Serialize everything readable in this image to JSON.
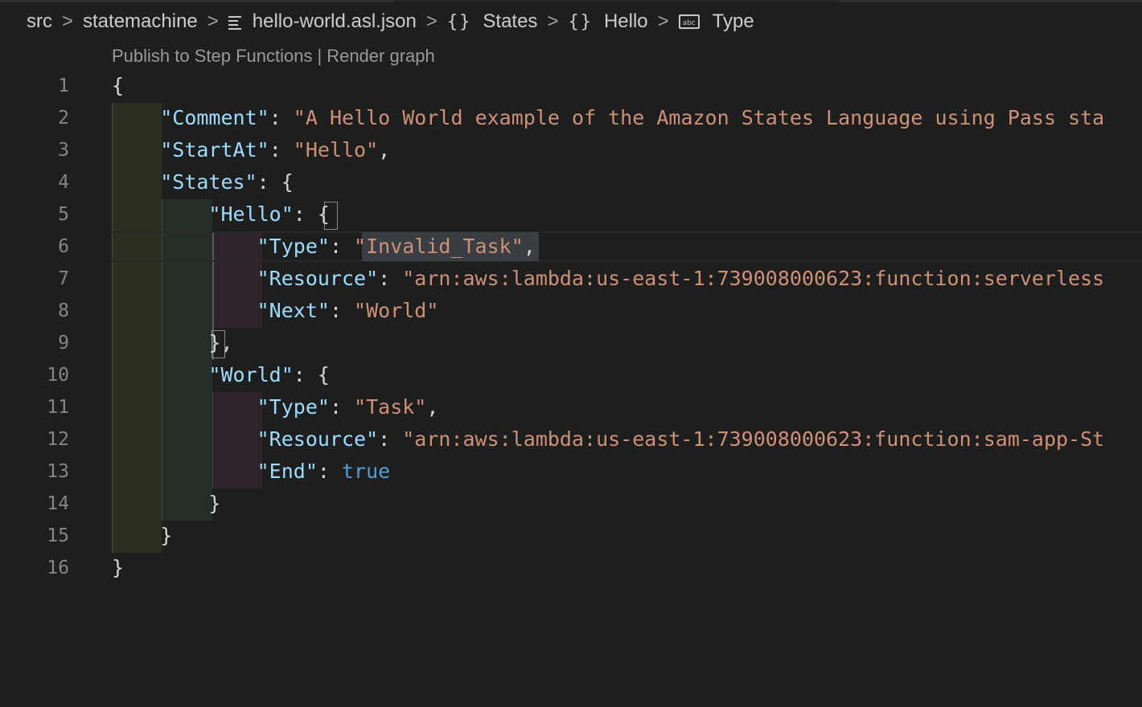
{
  "breadcrumb": {
    "items": [
      {
        "label": "src"
      },
      {
        "label": "statemachine"
      },
      {
        "label": "hello-world.asl.json",
        "icon": "file-lines-icon"
      },
      {
        "label": "States",
        "icon": "braces-icon"
      },
      {
        "label": "Hello",
        "icon": "braces-icon"
      },
      {
        "label": "Type",
        "icon": "string-abc-icon"
      }
    ],
    "separator": ">",
    "braces_glyph": "{}",
    "abc_glyph": "abc"
  },
  "codelens": {
    "publish": "Publish to Step Functions",
    "separator": "|",
    "render": "Render graph"
  },
  "line_numbers": [
    "1",
    "2",
    "3",
    "4",
    "5",
    "6",
    "7",
    "8",
    "9",
    "10",
    "11",
    "12",
    "13",
    "14",
    "15",
    "16"
  ],
  "code": {
    "l1": {
      "brace": "{"
    },
    "l2": {
      "key": "\"Comment\"",
      "colon": ": ",
      "value": "\"A Hello World example of the Amazon States Language using Pass sta"
    },
    "l3": {
      "key": "\"StartAt\"",
      "colon": ": ",
      "value": "\"Hello\"",
      "comma": ","
    },
    "l4": {
      "key": "\"States\"",
      "colon": ": ",
      "brace": "{"
    },
    "l5": {
      "key": "\"Hello\"",
      "colon": ": ",
      "brace": "{"
    },
    "l6": {
      "key": "\"Type\"",
      "colon": ": ",
      "value": "\"Invalid_Task\"",
      "comma": ","
    },
    "l7": {
      "key": "\"Resource\"",
      "colon": ": ",
      "value": "\"arn:aws:lambda:us-east-1:739008000623:function:serverless"
    },
    "l8": {
      "key": "\"Next\"",
      "colon": ": ",
      "value": "\"World\""
    },
    "l9": {
      "brace": "}",
      "comma": ","
    },
    "l10": {
      "key": "\"World\"",
      "colon": ": ",
      "brace": "{"
    },
    "l11": {
      "key": "\"Type\"",
      "colon": ": ",
      "value": "\"Task\"",
      "comma": ","
    },
    "l12": {
      "key": "\"Resource\"",
      "colon": ": ",
      "value": "\"arn:aws:lambda:us-east-1:739008000623:function:sam-app-St"
    },
    "l13": {
      "key": "\"End\"",
      "colon": ": ",
      "value": "true"
    },
    "l14": {
      "brace": "}"
    },
    "l15": {
      "brace": "}"
    },
    "l16": {
      "brace": "}"
    }
  },
  "colors": {
    "background": "#1e1e1e",
    "key": "#9cdcfe",
    "string": "#ce9178",
    "boolean": "#569cd6",
    "punctuation": "#d4d4d4",
    "line_number": "#858585",
    "indent_level_1": "#2c2e22",
    "indent_level_2": "#242e27",
    "indent_level_3": "#2e242b"
  }
}
